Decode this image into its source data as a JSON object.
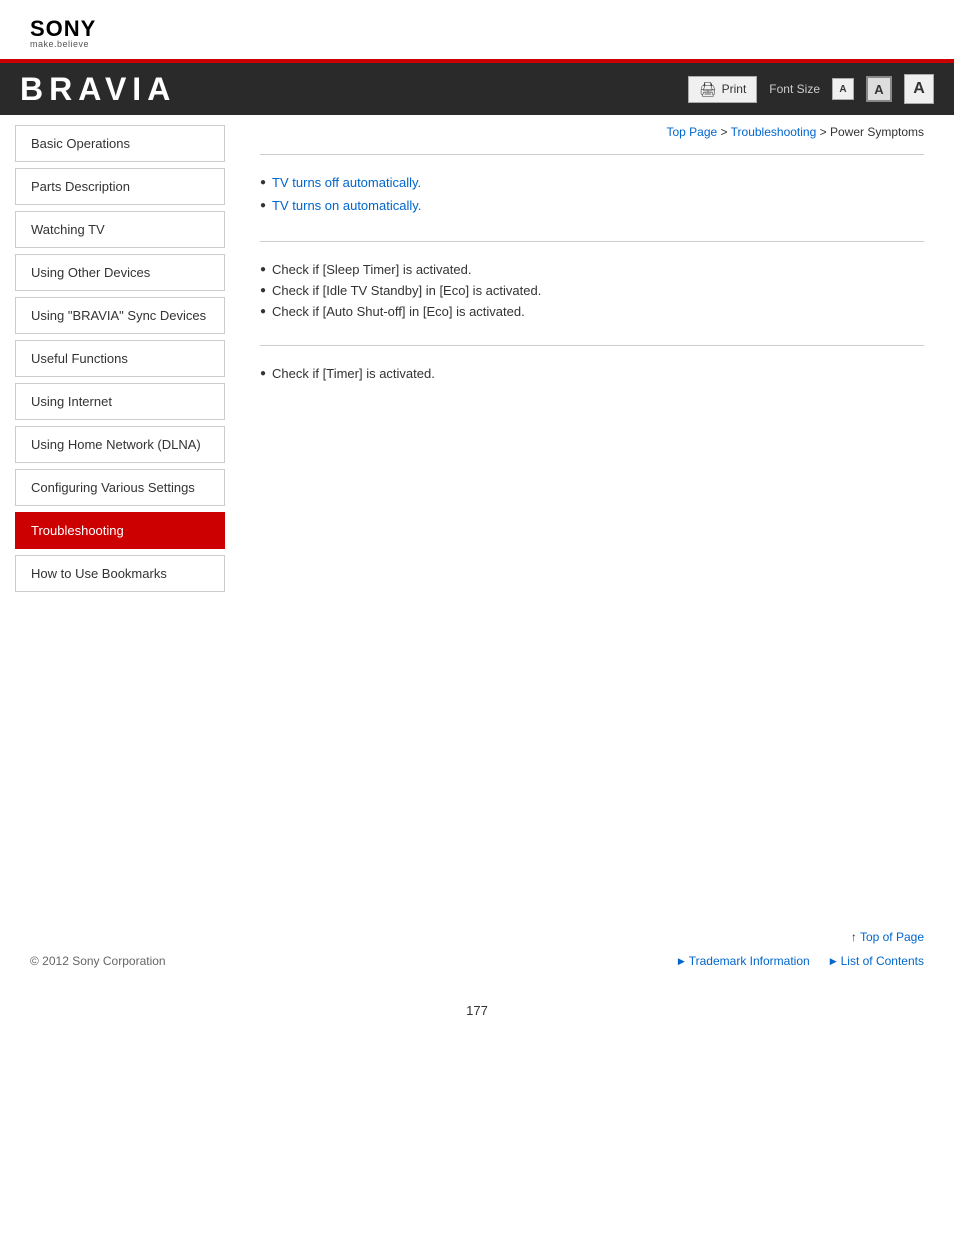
{
  "header": {
    "logo": "SONY",
    "tagline": "make.believe"
  },
  "banner": {
    "title": "BRAVIA",
    "print_label": "Print",
    "font_size_label": "Font Size",
    "font_small": "A",
    "font_medium": "A",
    "font_large": "A"
  },
  "breadcrumb": {
    "top_page": "Top Page",
    "separator1": " > ",
    "troubleshooting": "Troubleshooting",
    "separator2": " > ",
    "current": "Power Symptoms"
  },
  "sidebar": {
    "items": [
      {
        "id": "basic-operations",
        "label": "Basic Operations",
        "active": false
      },
      {
        "id": "parts-description",
        "label": "Parts Description",
        "active": false
      },
      {
        "id": "watching-tv",
        "label": "Watching TV",
        "active": false
      },
      {
        "id": "using-other-devices",
        "label": "Using Other Devices",
        "active": false
      },
      {
        "id": "using-bravia-sync",
        "label": "Using \"BRAVIA\" Sync Devices",
        "active": false
      },
      {
        "id": "useful-functions",
        "label": "Useful Functions",
        "active": false
      },
      {
        "id": "using-internet",
        "label": "Using Internet",
        "active": false
      },
      {
        "id": "using-home-network",
        "label": "Using Home Network (DLNA)",
        "active": false
      },
      {
        "id": "configuring-settings",
        "label": "Configuring Various Settings",
        "active": false
      },
      {
        "id": "troubleshooting",
        "label": "Troubleshooting",
        "active": true
      },
      {
        "id": "how-to-use-bookmarks",
        "label": "How to Use Bookmarks",
        "active": false
      }
    ]
  },
  "content": {
    "section1": {
      "links": [
        {
          "text": "TV turns off automatically.",
          "href": "#"
        },
        {
          "text": "TV turns on automatically.",
          "href": "#"
        }
      ]
    },
    "section2": {
      "bullets": [
        "Check if [Sleep Timer] is activated.",
        "Check if [Idle TV Standby] in [Eco] is activated.",
        "Check if [Auto Shut-off] in [Eco] is activated."
      ]
    },
    "section3": {
      "bullets": [
        "Check if [Timer] is activated."
      ]
    }
  },
  "footer": {
    "top_of_page": "Top of Page",
    "copyright": "© 2012 Sony Corporation",
    "trademark": "Trademark Information",
    "list_of_contents": "List of Contents"
  },
  "page_number": "177"
}
